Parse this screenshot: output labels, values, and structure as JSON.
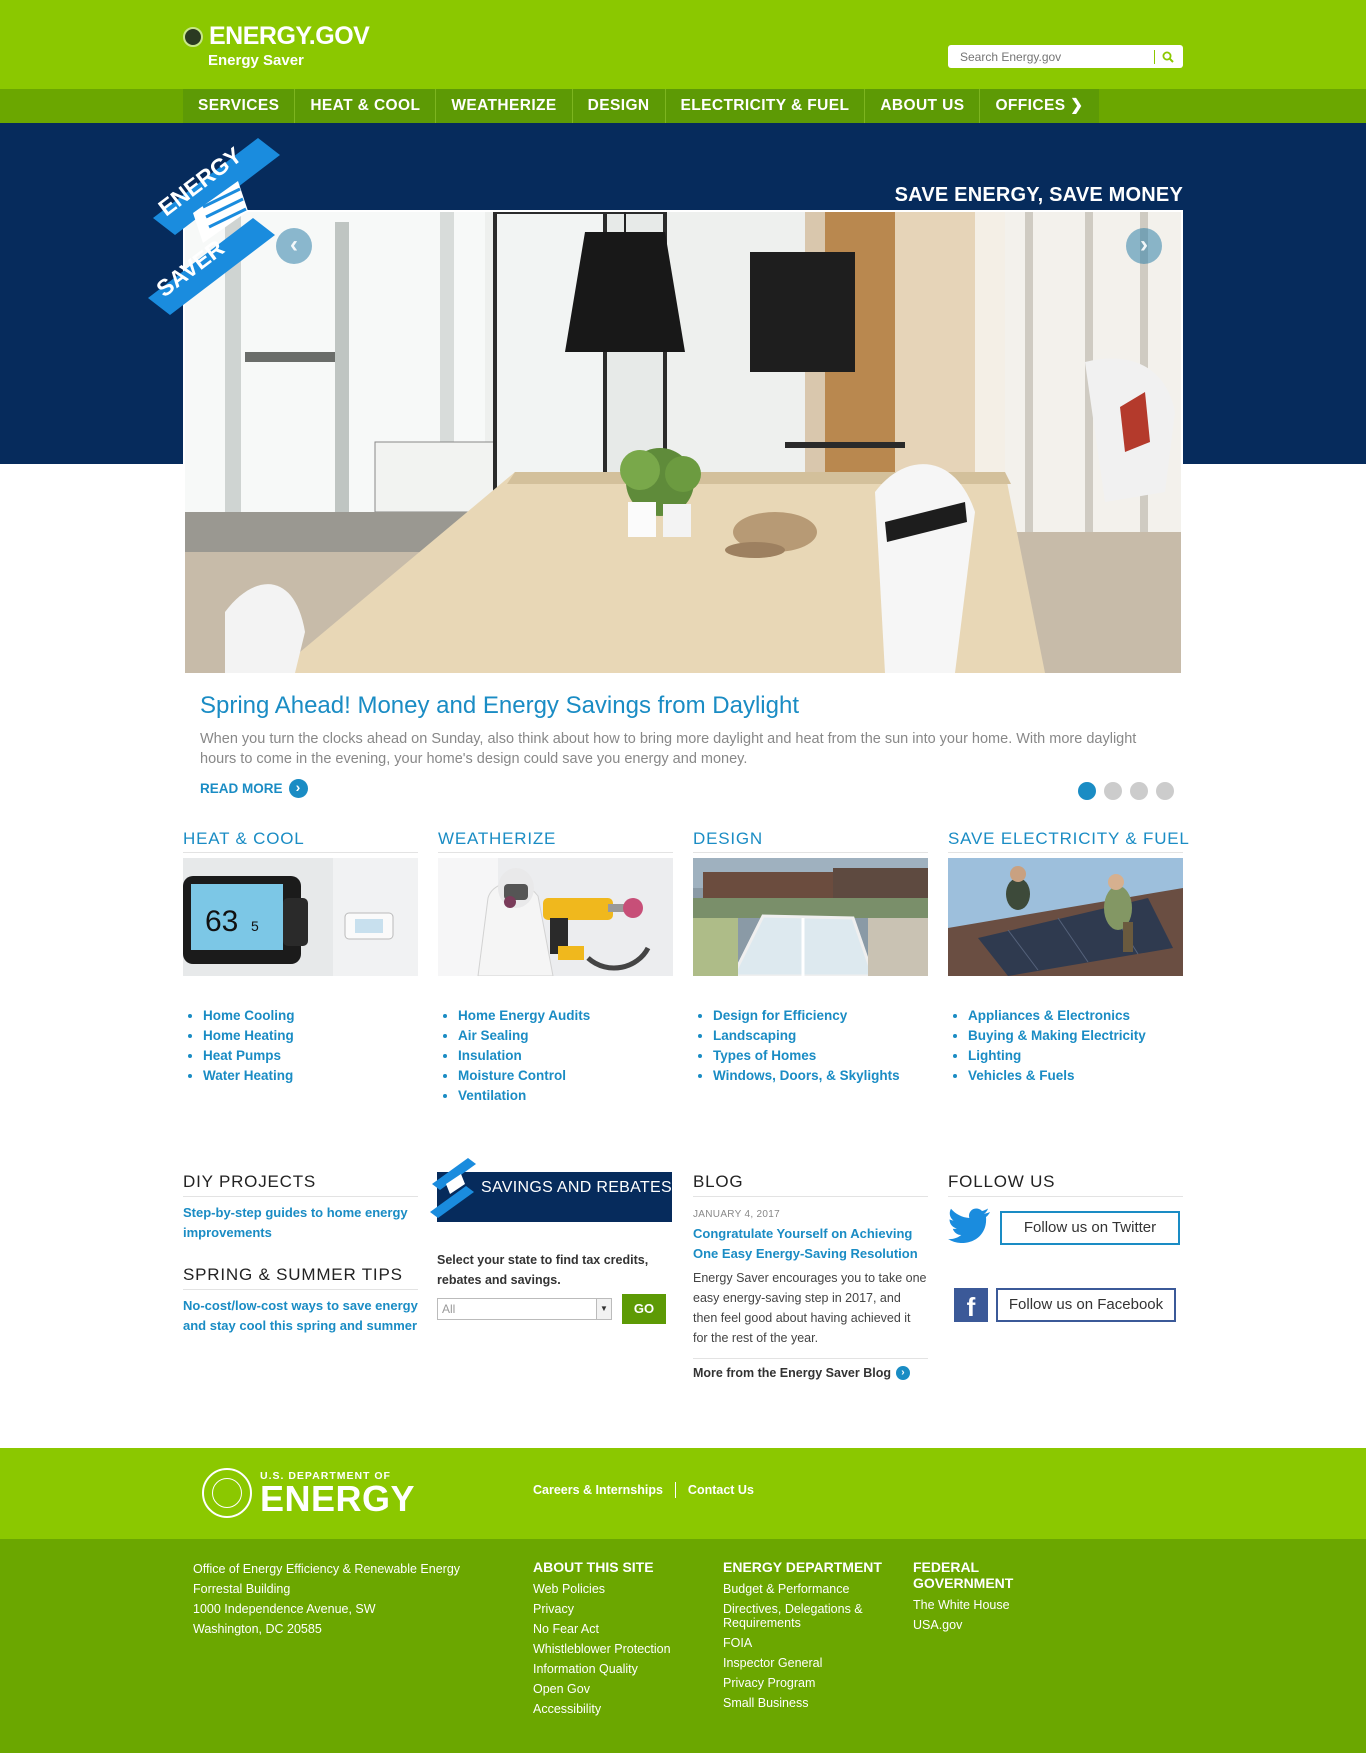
{
  "header": {
    "site_name": "ENERGY.GOV",
    "subsite": "Energy Saver",
    "search_placeholder": "Search Energy.gov"
  },
  "nav": {
    "items": [
      "SERVICES",
      "HEAT & COOL",
      "WEATHERIZE",
      "DESIGN",
      "ELECTRICITY & FUEL",
      "ABOUT US",
      "OFFICES"
    ]
  },
  "hero": {
    "tagline": "SAVE ENERGY, SAVE MONEY",
    "ribbon_top": "ENERGY",
    "ribbon_bottom": "SAVER",
    "slide_title": "Spring Ahead! Money and Energy Savings from Daylight",
    "slide_text": "When you turn the clocks ahead on Sunday, also think about how to bring more daylight and heat from the sun into your home. With more daylight hours to come in the evening, your home's design could save you energy and money.",
    "read_more": "READ MORE",
    "slide_count": 4,
    "active_slide": 1
  },
  "categories": [
    {
      "title": "HEAT & COOL",
      "thermostat_reading": "63",
      "thermostat_decimal": "5",
      "links": [
        "Home Cooling",
        "Home Heating",
        "Heat Pumps",
        "Water Heating"
      ]
    },
    {
      "title": "WEATHERIZE",
      "links": [
        "Home Energy Audits",
        "Air Sealing",
        "Insulation",
        "Moisture Control",
        "Ventilation"
      ]
    },
    {
      "title": "DESIGN",
      "links": [
        "Design for Efficiency",
        "Landscaping",
        "Types of Homes",
        "Windows, Doors, & Skylights"
      ]
    },
    {
      "title": "SAVE ELECTRICITY & FUEL",
      "links": [
        "Appliances & Electronics",
        "Buying & Making Electricity",
        "Lighting",
        "Vehicles & Fuels"
      ]
    }
  ],
  "diy": {
    "title": "DIY PROJECTS",
    "link": "Step-by-step guides to home energy improvements"
  },
  "tips": {
    "title": "SPRING & SUMMER TIPS",
    "link": "No-cost/low-cost ways to save energy and stay cool this spring and summer"
  },
  "savings": {
    "title": "SAVINGS AND REBATES",
    "description": "Select your state to find tax credits, rebates and savings.",
    "select_value": "All",
    "go_label": "GO"
  },
  "blog": {
    "title": "BLOG",
    "date": "JANUARY 4, 2017",
    "post_title": "Congratulate Yourself on Achieving One Easy Energy-Saving Resolution",
    "excerpt": "Energy Saver encourages you to take one easy energy-saving step in 2017, and then feel good about having achieved it for the rest of the year.",
    "more_link": "More from the Energy Saver Blog"
  },
  "follow": {
    "title": "FOLLOW US",
    "twitter": "Follow us on Twitter",
    "facebook": "Follow us on Facebook",
    "facebook_glyph": "f"
  },
  "footer": {
    "dept_line": "U.S. DEPARTMENT OF",
    "dept_name": "ENERGY",
    "top_links": [
      "Careers & Internships",
      "Contact Us"
    ],
    "address": [
      "Office of Energy Efficiency & Renewable Energy",
      "Forrestal Building",
      "1000 Independence Avenue, SW",
      "Washington, DC 20585"
    ],
    "about": {
      "title": "ABOUT THIS SITE",
      "links": [
        "Web Policies",
        "Privacy",
        "No Fear Act",
        "Whistleblower Protection",
        "Information Quality",
        "Open Gov",
        "Accessibility"
      ]
    },
    "energy_dept": {
      "title": "ENERGY DEPARTMENT",
      "links": [
        "Budget & Performance",
        "Directives, Delegations & Requirements",
        "FOIA",
        "Inspector General",
        "Privacy Program",
        "Small Business"
      ]
    },
    "federal": {
      "title": "FEDERAL GOVERNMENT",
      "links": [
        "The White House",
        "USA.gov"
      ]
    }
  },
  "colors": {
    "green": "#8bc800",
    "dark_green": "#6ba700",
    "navy": "#062b5c",
    "link_blue": "#1a8cc4"
  }
}
